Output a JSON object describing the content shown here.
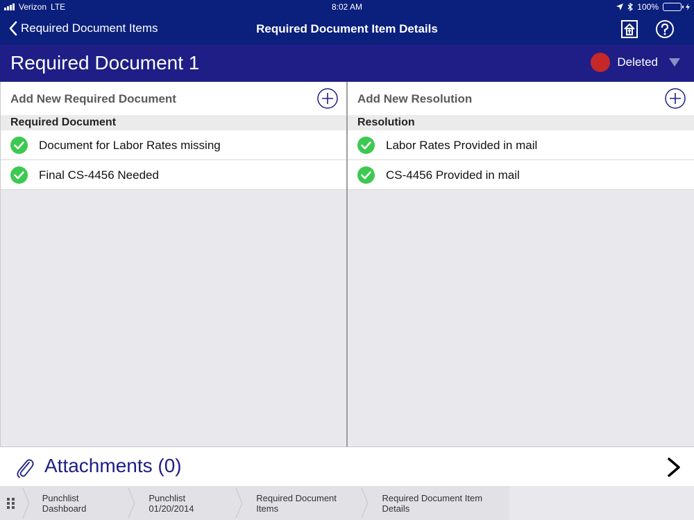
{
  "status_bar": {
    "carrier": "Verizon",
    "network": "LTE",
    "time": "8:02 AM",
    "battery": "100%"
  },
  "nav": {
    "back_label": "Required Document Items",
    "title": "Required Document Item Details"
  },
  "header": {
    "title": "Required Document 1",
    "status_label": "Deleted",
    "status_color": "#c62828"
  },
  "left_panel": {
    "add_label": "Add New Required Document",
    "section_header": "Required Document",
    "items": [
      {
        "label": "Document for Labor Rates missing"
      },
      {
        "label": "Final CS-4456 Needed"
      }
    ]
  },
  "right_panel": {
    "add_label": "Add New Resolution",
    "section_header": "Resolution",
    "items": [
      {
        "label": "Labor Rates Provided in mail"
      },
      {
        "label": "CS-4456 Provided in mail"
      }
    ]
  },
  "attachments": {
    "label": "Attachments (0)"
  },
  "breadcrumb": {
    "items": [
      "Punchlist Dashboard",
      "Punchlist 01/20/2014",
      "Required Document Items",
      "Required Document Item Details"
    ]
  },
  "colors": {
    "nav_bg": "#0b1f7c",
    "header_bg": "#1e1e86",
    "check_green": "#3cc951",
    "accent_navy": "#1e1e86"
  }
}
